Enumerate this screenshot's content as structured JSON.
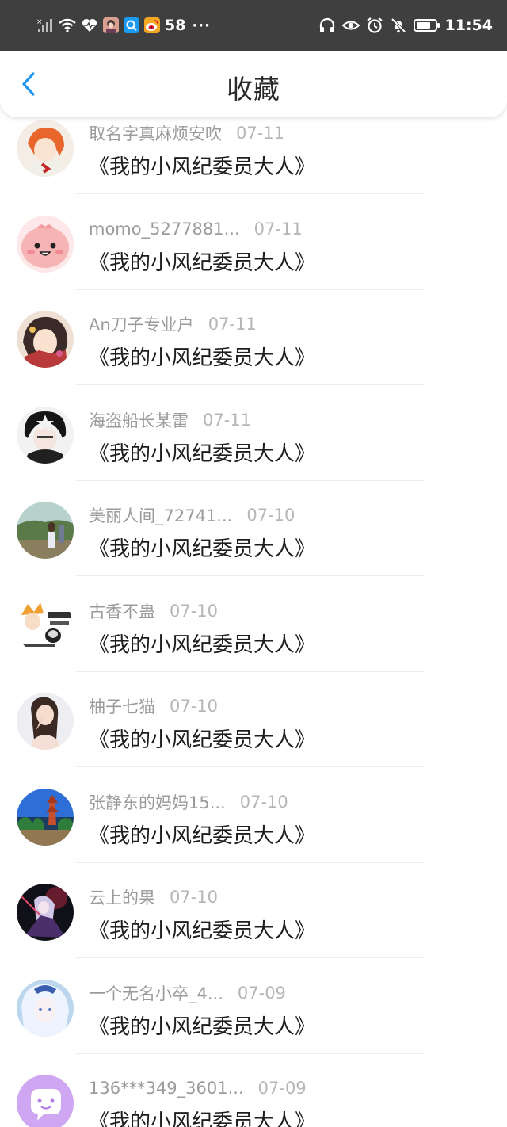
{
  "status_bar": {
    "notification_count": "58",
    "more": "···",
    "time": "11:54",
    "battery_level": 0.75,
    "left_icons": [
      "no-sim-signal-icon",
      "wifi-icon",
      "heart-rate-icon",
      "avatar-app-icon",
      "search-app-icon",
      "weibo-app-icon"
    ],
    "right_icons": [
      "headphones-icon",
      "eye-comfort-icon",
      "alarm-icon",
      "mute-icon",
      "battery-icon"
    ]
  },
  "header": {
    "title": "收藏",
    "back_icon": "chevron-left-icon",
    "accent_color": "#2196f3"
  },
  "favorites": [
    {
      "user": "取名字真麻烦安吹",
      "date": "07-11",
      "book": "《我的小风纪委员大人》"
    },
    {
      "user": "momo_5277881...",
      "date": "07-11",
      "book": "《我的小风纪委员大人》"
    },
    {
      "user": "An刀子专业户",
      "date": "07-11",
      "book": "《我的小风纪委员大人》"
    },
    {
      "user": "海盗船长某雷",
      "date": "07-11",
      "book": "《我的小风纪委员大人》"
    },
    {
      "user": "美丽人间_72741...",
      "date": "07-10",
      "book": "《我的小风纪委员大人》"
    },
    {
      "user": "古香不蛊",
      "date": "07-10",
      "book": "《我的小风纪委员大人》"
    },
    {
      "user": "柚子七猫",
      "date": "07-10",
      "book": "《我的小风纪委员大人》"
    },
    {
      "user": "张静东的妈妈15...",
      "date": "07-10",
      "book": "《我的小风纪委员大人》"
    },
    {
      "user": "云上的果",
      "date": "07-10",
      "book": "《我的小风纪委员大人》"
    },
    {
      "user": "一个无名小卒_4...",
      "date": "07-09",
      "book": "《我的小风纪委员大人》"
    },
    {
      "user": "136***349_3601...",
      "date": "07-09",
      "book": "《我的小风纪委员大人》"
    }
  ]
}
